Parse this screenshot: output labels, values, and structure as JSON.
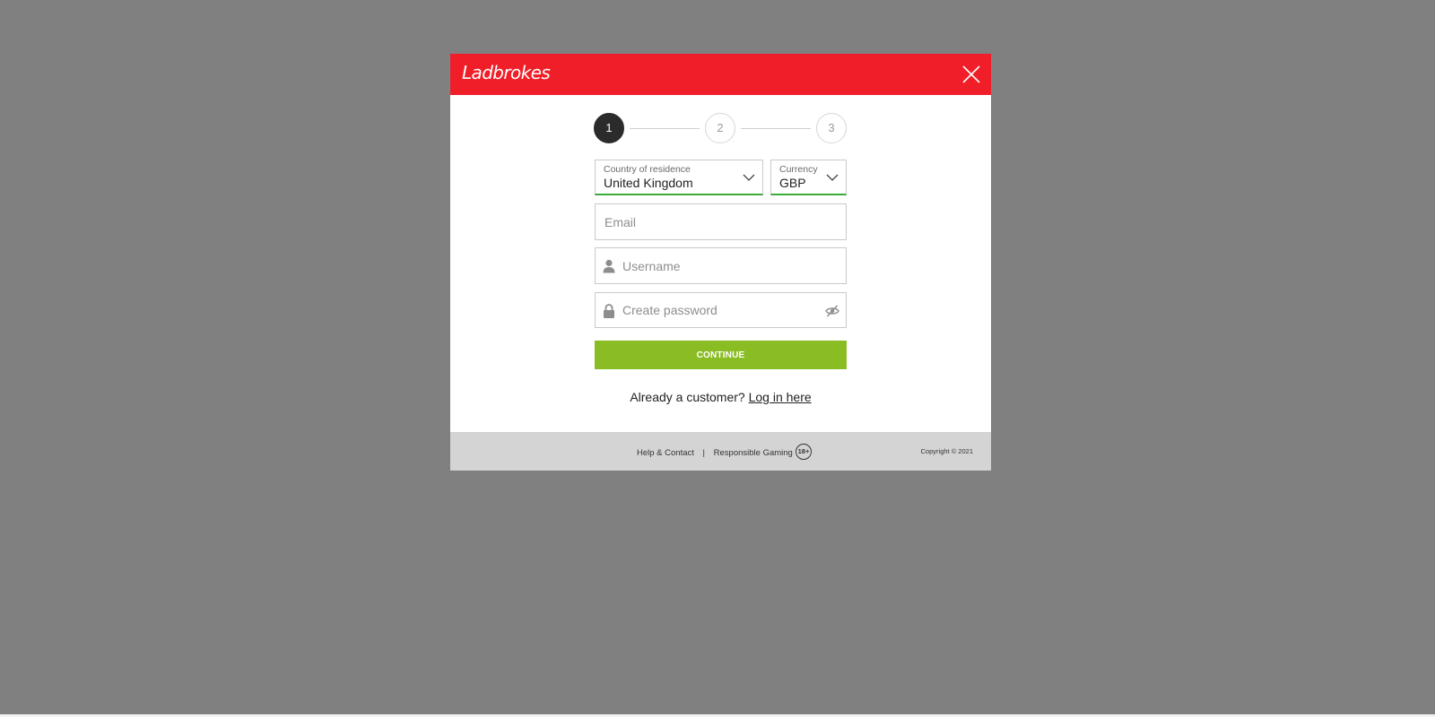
{
  "colors": {
    "overlay": "#808080",
    "brand_red": "#f01e28",
    "active_step": "#2b2b2b",
    "valid_green": "#3cab3c",
    "continue_green": "#8abd24",
    "footer_gray": "#d4d4d4"
  },
  "header": {
    "logo_text": "Ladbrokes",
    "close_icon": "close-icon"
  },
  "stepper": {
    "steps": [
      {
        "label": "1",
        "state": "active"
      },
      {
        "label": "2",
        "state": "inactive"
      },
      {
        "label": "3",
        "state": "inactive"
      }
    ]
  },
  "form": {
    "country": {
      "label": "Country of residence",
      "value": "United Kingdom"
    },
    "currency": {
      "label": "Currency",
      "value": "GBP"
    },
    "email": {
      "placeholder": "Email",
      "value": ""
    },
    "username": {
      "placeholder": "Username",
      "value": "",
      "icon": "user-icon"
    },
    "password": {
      "placeholder": "Create password",
      "value": "",
      "icon": "lock-icon",
      "toggle_icon": "eye-slash-icon"
    },
    "continue_label": "CONTINUE"
  },
  "login": {
    "prompt": "Already a customer?",
    "link_text": "Log in here"
  },
  "footer": {
    "help_link": "Help & Contact",
    "separator": "|",
    "responsible_link": "Responsible Gaming",
    "age_badge": "18+",
    "copyright": "Copyright © 2021"
  }
}
